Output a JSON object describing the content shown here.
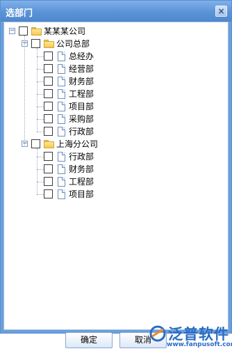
{
  "window": {
    "title": "选部门",
    "close_glyph": "×"
  },
  "tree": {
    "root": {
      "label": "某某某公司",
      "toggle": "−"
    },
    "groups": [
      {
        "label": "公司总部",
        "toggle": "−",
        "items": [
          "总经办",
          "经营部",
          "财务部",
          "工程部",
          "项目部",
          "采购部",
          "行政部"
        ]
      },
      {
        "label": "上海分公司",
        "toggle": "−",
        "items": [
          "行政部",
          "财务部",
          "工程部",
          "项目部"
        ]
      }
    ]
  },
  "buttons": {
    "ok": "确定",
    "cancel": "取消"
  },
  "brand": {
    "name": "泛普软件",
    "url": "www.fanpusoft.com"
  }
}
